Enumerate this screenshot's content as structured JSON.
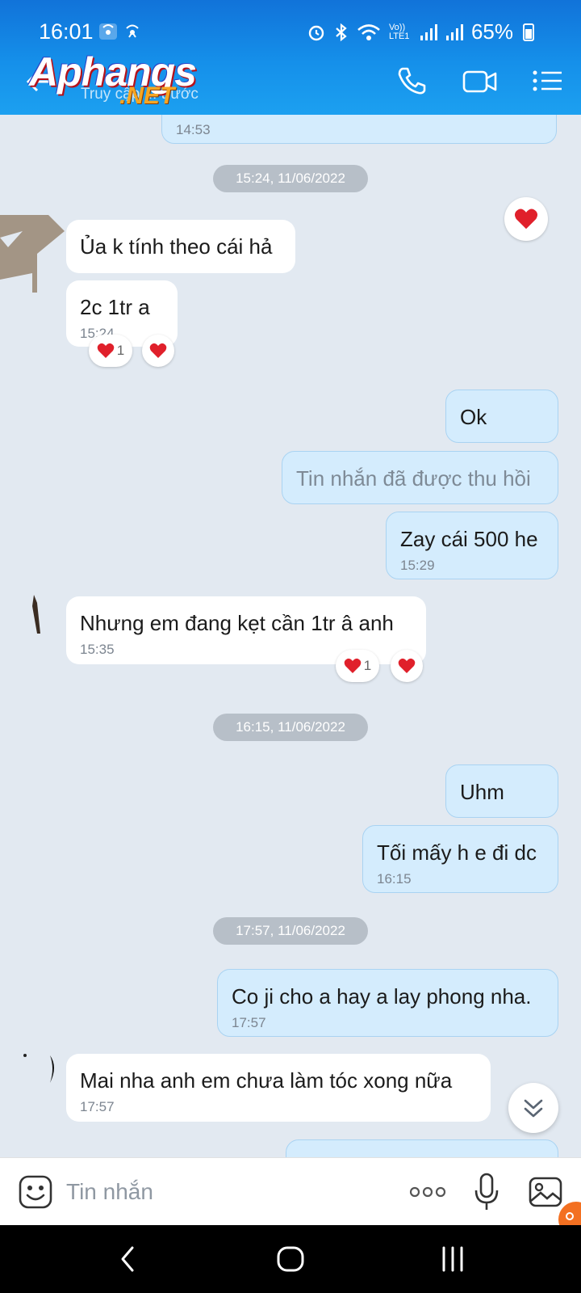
{
  "status_bar": {
    "time": "16:01",
    "notif_icons": [
      "hotspot-icon",
      "hotspot-icon"
    ],
    "network_label": "Vo)) LTE1",
    "battery": "65%"
  },
  "header": {
    "watermark_logo": "Aphangs",
    "watermark_logo_suffix": ".NET",
    "subtitle": "Truy cập ... trước",
    "accent_color": "#1590ea"
  },
  "messages": [
    {
      "dir": "out",
      "text": "",
      "time": "14:53"
    },
    {
      "dir": "date",
      "text": "15:24, 11/06/2022"
    },
    {
      "dir": "in",
      "text": "Ủa k tính theo cái hả",
      "time": ""
    },
    {
      "dir": "in",
      "text": "2c 1tr a",
      "time": "15:24",
      "reaction_count": "1"
    },
    {
      "dir": "out",
      "text": "Ok",
      "time": ""
    },
    {
      "dir": "out",
      "text": "Tin nhắn đã được thu hồi",
      "time": "",
      "recalled": true
    },
    {
      "dir": "out",
      "text": "Zay cái 500 he",
      "time": "15:29"
    },
    {
      "dir": "in",
      "text": "Nhưng em đang kẹt cần 1tr â anh",
      "time": "15:35",
      "reaction_count": "1"
    },
    {
      "dir": "date",
      "text": "16:15, 11/06/2022"
    },
    {
      "dir": "out",
      "text": "Uhm",
      "time": ""
    },
    {
      "dir": "out",
      "text": "Tối mấy h e đi dc",
      "time": "16:15"
    },
    {
      "dir": "date",
      "text": "17:57, 11/06/2022"
    },
    {
      "dir": "out",
      "text": "Co ji cho a hay a lay phong nha.",
      "time": "17:57"
    },
    {
      "dir": "in",
      "text": "Mai nha anh em chưa làm tóc xong nữa",
      "time": "17:57"
    }
  ],
  "input": {
    "placeholder": "Tin nhắn"
  },
  "colors": {
    "bubble_out": "#d4ecfd",
    "bubble_in": "#ffffff",
    "background": "#e2e9f1",
    "heart": "#e0202b"
  }
}
